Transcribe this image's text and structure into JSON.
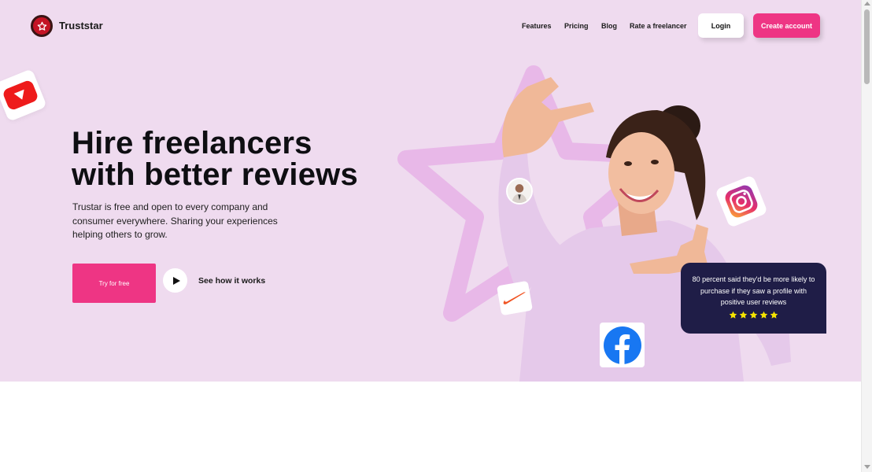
{
  "brand": {
    "name": "Truststar"
  },
  "nav": {
    "links": [
      "Features",
      "Pricing",
      "Blog",
      "Rate a freelancer"
    ],
    "login_label": "Login",
    "create_label": "Create account"
  },
  "hero": {
    "headline_line1": "Hire freelancers",
    "headline_line2": "with better reviews",
    "subtext": "Trustar is free and open to every company and consumer everywhere. Sharing your experiences helping others to grow.",
    "try_label": "Try for free",
    "see_how_label": "See how it works"
  },
  "review_card": {
    "text": "80 percent said they'd be more likely to purchase if they saw a profile with positive user reviews",
    "rating": 5,
    "max_rating": 5
  },
  "icons": {
    "logo": "star-icon",
    "youtube": "youtube-icon",
    "instagram": "instagram-icon",
    "nike": "nike-icon",
    "facebook": "facebook-icon",
    "play": "play-icon"
  },
  "colors": {
    "hero_bg": "#efdbef",
    "accent_pink": "#ee3584",
    "review_bg": "#1f1d47",
    "star_yellow": "#f5e400",
    "logo_red": "#c41425"
  }
}
